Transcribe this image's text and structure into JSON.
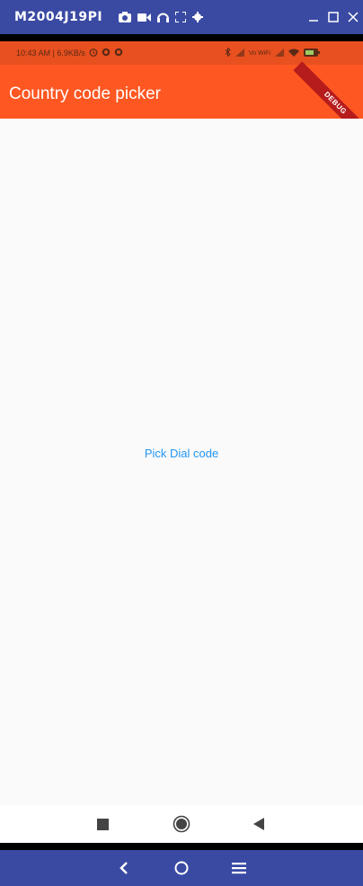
{
  "window": {
    "title": "M2004J19PI",
    "tools": [
      "camera-icon",
      "video-icon",
      "headphones-icon",
      "fullscreen-icon",
      "gear-icon"
    ],
    "controls": [
      "minimize-icon",
      "maximize-icon",
      "close-icon"
    ]
  },
  "status_bar": {
    "time_speed": "10:43 AM | 6.9KB/s",
    "icons": [
      "alarm-icon",
      "app-icon",
      "app-icon",
      "bluetooth-icon",
      "signal-icon",
      "signal-icon",
      "wifi-icon",
      "battery-icon"
    ],
    "vo_wifi": "Vo WiFi"
  },
  "app_bar": {
    "title": "Country code picker",
    "debug_banner": "DEBUG"
  },
  "main": {
    "pick_button_label": "Pick Dial code"
  },
  "phone_nav": [
    "recents-icon",
    "home-icon",
    "back-icon"
  ],
  "host_nav": [
    "back-icon",
    "home-icon",
    "menu-icon"
  ],
  "colors": {
    "primary": "#fe5722",
    "accent": "#2196f3",
    "window_bar": "#3a4aa3"
  }
}
